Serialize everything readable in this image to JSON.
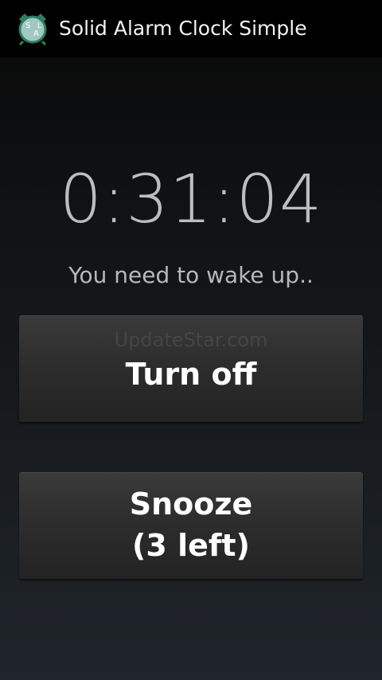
{
  "app": {
    "title": "Solid Alarm Clock Simple",
    "icon": "alarm-clock-app-icon"
  },
  "alarm": {
    "time": "0:31:04",
    "message": "You need to wake up.."
  },
  "buttons": {
    "turn_off_label": "Turn off",
    "snooze_label_line1": "Snooze",
    "snooze_label_line2": "(3 left)"
  },
  "watermark": "UpdateStar.com"
}
